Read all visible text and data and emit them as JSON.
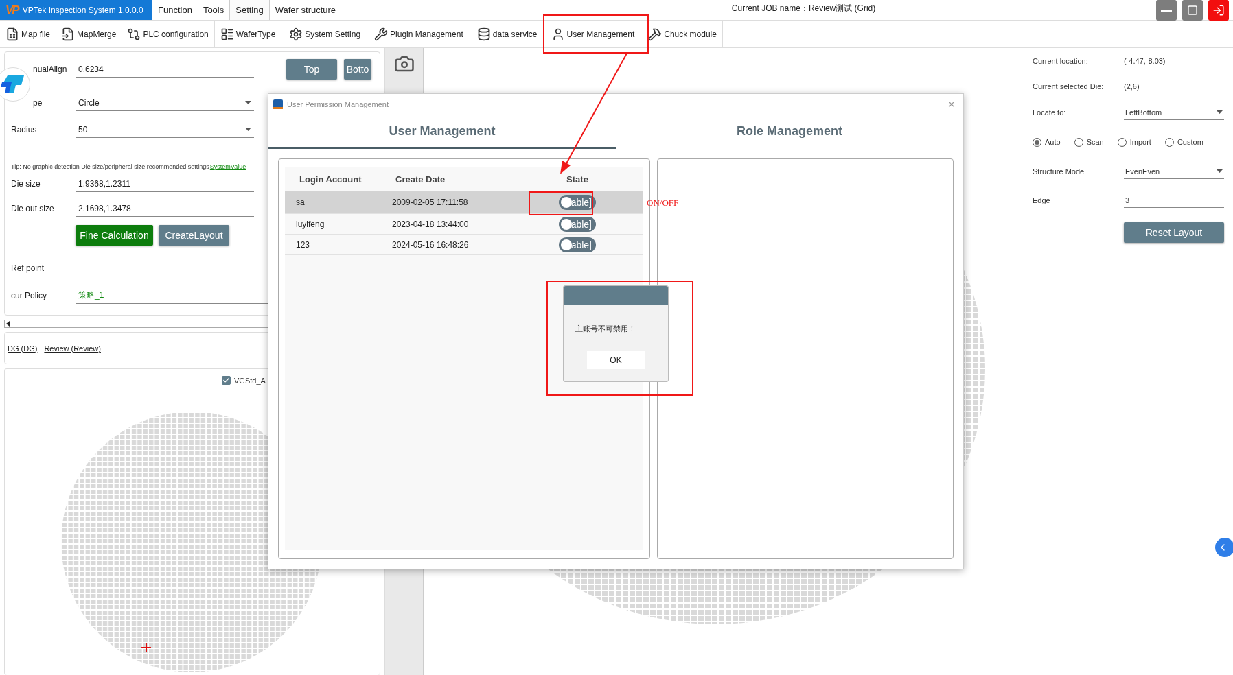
{
  "app": {
    "logo": "VP",
    "title": "VPTek Inspection System 1.0.0.0",
    "job": "Current JOB name：Review测试 (Grid)"
  },
  "menu": [
    {
      "label": "Function",
      "selected": false
    },
    {
      "label": "Tools",
      "selected": false
    },
    {
      "label": "Setting",
      "selected": true
    },
    {
      "label": "Wafer structure",
      "selected": false
    }
  ],
  "toolbar_groups": [
    [
      "Map file",
      "MapMerge",
      "PLC configuration"
    ],
    [
      "WaferType",
      "System Setting",
      "Plugin Management",
      "data service",
      "User Management",
      "Chuck module"
    ]
  ],
  "layout_form": {
    "rows": [
      {
        "label": "nualAlign",
        "value": "0.6234",
        "kind": "text",
        "buttons": [
          "Top",
          "Botto"
        ]
      },
      {
        "label": "pe",
        "value": "Circle",
        "kind": "dropdown"
      },
      {
        "label": "Radius",
        "value": "50",
        "kind": "dropdown"
      }
    ],
    "tip": "Tip: No graphic detection Die size/peripheral size recommended settings",
    "tip_link": "SystemValue",
    "size_rows": [
      {
        "label": "Die size",
        "value": "1.9368,1.2311"
      },
      {
        "label": "Die out size",
        "value": "2.1698,1.3478"
      }
    ],
    "actions": [
      {
        "label": "Fine Calculation",
        "kind": "primary"
      },
      {
        "label": "CreateLayout",
        "kind": "secondary"
      }
    ],
    "ref_point": {
      "label": "Ref point"
    },
    "policy": {
      "label": "cur Policy",
      "value": "策略_1"
    }
  },
  "recipes": [
    "DG (DG)",
    "Review (Review)"
  ],
  "map_panel": {
    "layer": {
      "label": "VGStd_A",
      "checked": true
    }
  },
  "info_panel": {
    "rows": [
      {
        "label": "Current location:",
        "value": "(-4.47,-8.03)"
      },
      {
        "label": "Current selected Die:",
        "value": "(2,6)"
      }
    ],
    "locate": {
      "label": "Locate to:",
      "value": "LeftBottom"
    },
    "modes": [
      {
        "label": "Auto",
        "selected": true
      },
      {
        "label": "Scan",
        "selected": false
      },
      {
        "label": "Import",
        "selected": false
      },
      {
        "label": "Custom",
        "selected": false
      }
    ],
    "structure": {
      "label": "Structure Mode",
      "value": "EvenEven"
    },
    "edge": {
      "label": "Edge",
      "value": "3"
    },
    "reset": "Reset Layout"
  },
  "dialog": {
    "title": "User Permission Management",
    "tabs": [
      {
        "label": "User Management",
        "selected": true
      },
      {
        "label": "Role Management",
        "selected": false
      }
    ],
    "columns": [
      "Login Account",
      "Create Date",
      "State"
    ],
    "rows": [
      {
        "account": "sa",
        "created": "2009-02-05 17:11:58",
        "toggle": "able]",
        "on": false,
        "selected": true
      },
      {
        "account": "luyifeng",
        "created": "2023-04-18 13:44:00",
        "toggle": "able]",
        "on": false,
        "selected": false
      },
      {
        "account": "123",
        "created": "2024-05-16 16:48:26",
        "toggle": "able]",
        "on": false,
        "selected": false
      }
    ]
  },
  "message": {
    "text": "主账号不可禁用！",
    "button": "OK"
  },
  "annotation": {
    "note": "ON/OFF"
  }
}
